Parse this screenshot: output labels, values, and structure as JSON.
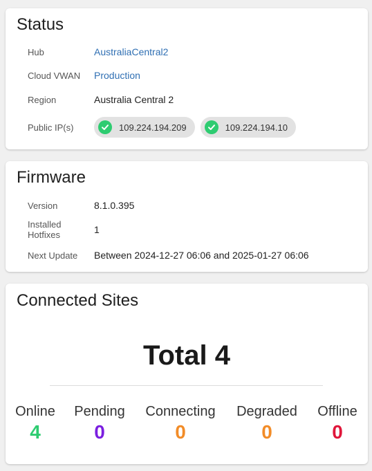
{
  "status": {
    "title": "Status",
    "hub_label": "Hub",
    "hub_value": "AustraliaCentral2",
    "vwan_label": "Cloud VWAN",
    "vwan_value": "Production",
    "region_label": "Region",
    "region_value": "Australia Central 2",
    "publicip_label": "Public IP(s)",
    "public_ips": [
      "109.224.194.209",
      "109.224.194.10"
    ],
    "ip_status_icon": "check-circle-icon",
    "ip_status_color": "#2ecc71"
  },
  "firmware": {
    "title": "Firmware",
    "version_label": "Version",
    "version_value": "8.1.0.395",
    "hotfixes_label": "Installed Hotfixes",
    "hotfixes_value": "1",
    "next_update_label": "Next Update",
    "next_update_value": "Between 2024-12-27 06:06 and 2025-01-27 06:06"
  },
  "connected_sites": {
    "title": "Connected Sites",
    "total_text": "Total 4",
    "stats": [
      {
        "label": "Online",
        "count": "4",
        "color": "#2ecc71"
      },
      {
        "label": "Pending",
        "count": "0",
        "color": "#7b1fe0"
      },
      {
        "label": "Connecting",
        "count": "0",
        "color": "#f28c28"
      },
      {
        "label": "Degraded",
        "count": "0",
        "color": "#f28c28"
      },
      {
        "label": "Offline",
        "count": "0",
        "color": "#e0163a"
      }
    ]
  },
  "colors": {
    "link": "#2f6fb3",
    "card_bg": "#ffffff",
    "page_bg": "#f0f0f0"
  }
}
